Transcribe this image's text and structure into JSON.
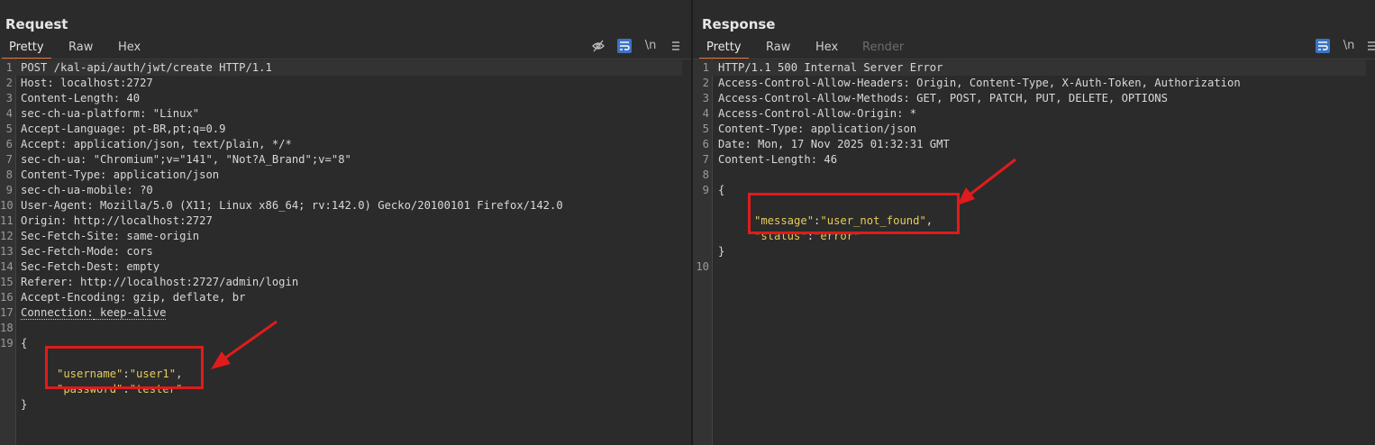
{
  "request": {
    "title": "Request",
    "tabs": [
      "Pretty",
      "Raw",
      "Hex"
    ],
    "icons": [
      "eye-off-icon",
      "wrap-icon",
      "newline-icon",
      "menu-icon"
    ],
    "newline_label": "\\n",
    "lines": [
      {
        "n": "1",
        "key": "POST /kal-api/auth/jwt/create HTTP/1.1",
        "val": ""
      },
      {
        "n": "2",
        "key": "Host:",
        "val": " localhost:2727"
      },
      {
        "n": "3",
        "key": "Content-Length:",
        "val": " 40"
      },
      {
        "n": "4",
        "key": "sec-ch-ua-platform:",
        "val": " \"Linux\""
      },
      {
        "n": "5",
        "key": "Accept-Language:",
        "val": " pt-BR,pt;q=0.9"
      },
      {
        "n": "6",
        "key": "Accept:",
        "val": " application/json, text/plain, */*"
      },
      {
        "n": "7",
        "key": "sec-ch-ua:",
        "val": " \"Chromium\";v=\"141\", \"Not?A_Brand\";v=\"8\""
      },
      {
        "n": "8",
        "key": "Content-Type:",
        "val": " application/json"
      },
      {
        "n": "9",
        "key": "sec-ch-ua-mobile:",
        "val": " ?0"
      },
      {
        "n": "10",
        "key": "User-Agent:",
        "val": " Mozilla/5.0 (X11; Linux x86_64; rv:142.0) Gecko/20100101 Firefox/142.0"
      },
      {
        "n": "11",
        "key": "Origin:",
        "val": " http://localhost:2727"
      },
      {
        "n": "12",
        "key": "Sec-Fetch-Site:",
        "val": " same-origin"
      },
      {
        "n": "13",
        "key": "Sec-Fetch-Mode:",
        "val": " cors"
      },
      {
        "n": "14",
        "key": "Sec-Fetch-Dest:",
        "val": " empty"
      },
      {
        "n": "15",
        "key": "Referer:",
        "val": " http://localhost:2727/admin/login"
      },
      {
        "n": "16",
        "key": "Accept-Encoding:",
        "val": " gzip, deflate, br"
      },
      {
        "n": "17",
        "key": "Connection:",
        "val": " keep-alive"
      },
      {
        "n": "18",
        "key": "",
        "val": ""
      },
      {
        "n": "19",
        "key": "{",
        "val": ""
      }
    ],
    "body": {
      "line1_key": "\"username\"",
      "line1_sep": ":",
      "line1_val": "\"user1\"",
      "line1_end": ",",
      "line2_key": "\"password\"",
      "line2_sep": ":",
      "line2_val": "\"tester\"",
      "close": "}"
    }
  },
  "response": {
    "title": "Response",
    "tabs": [
      "Pretty",
      "Raw",
      "Hex",
      "Render"
    ],
    "icons": [
      "wrap-icon",
      "newline-icon",
      "menu-icon"
    ],
    "newline_label": "\\n",
    "lines": [
      {
        "n": "1",
        "key": "HTTP/1.1 500 Internal Server Error",
        "val": ""
      },
      {
        "n": "2",
        "key": "Access-Control-Allow-Headers:",
        "val": " Origin, Content-Type, X-Auth-Token, Authorization"
      },
      {
        "n": "3",
        "key": "Access-Control-Allow-Methods:",
        "val": " GET, POST, PATCH, PUT, DELETE, OPTIONS"
      },
      {
        "n": "4",
        "key": "Access-Control-Allow-Origin:",
        "val": " *"
      },
      {
        "n": "5",
        "key": "Content-Type:",
        "val": " application/json"
      },
      {
        "n": "6",
        "key": "Date:",
        "val": " Mon, 17 Nov 2025 01:32:31 GMT"
      },
      {
        "n": "7",
        "key": "Content-Length:",
        "val": " 46"
      },
      {
        "n": "8",
        "key": "",
        "val": ""
      },
      {
        "n": "9",
        "key": "{",
        "val": ""
      }
    ],
    "body": {
      "line1_key": "\"message\"",
      "line1_sep": ":",
      "line1_val": "\"user_not_found\"",
      "line1_end": ",",
      "line2_key": "\"status\"",
      "line2_sep": ":",
      "line2_val": "\"error\"",
      "close": "}",
      "last_line_number": "10"
    }
  },
  "colors": {
    "accent": "#e8703a",
    "highlight_box": "#e01b1b",
    "active_icon": "#3b73c4",
    "json_string": "#e5cc5a"
  }
}
